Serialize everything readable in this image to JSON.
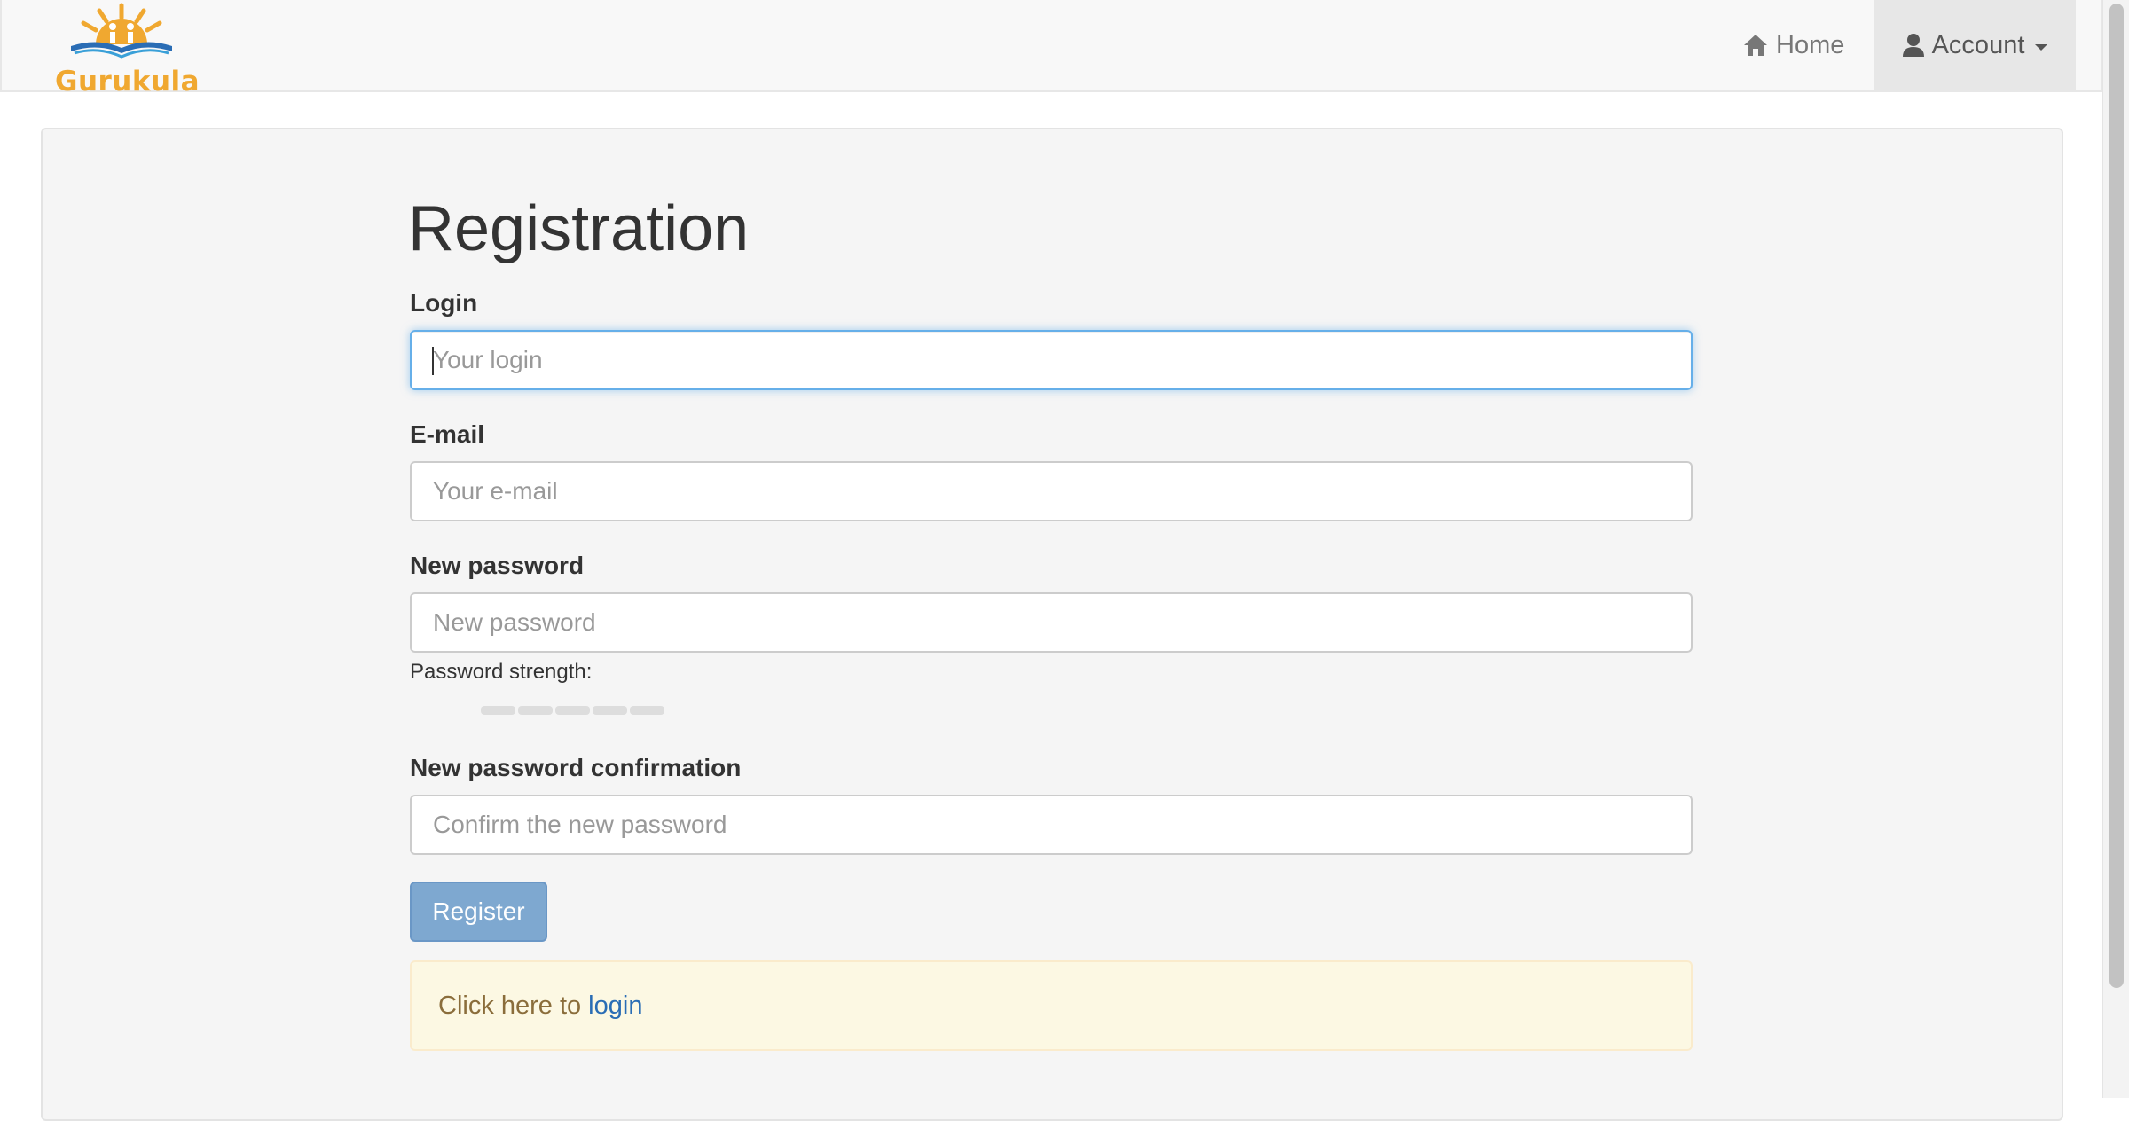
{
  "brand": {
    "name": "Gurukula",
    "logo_icon": "book-sun-logo-icon",
    "color": "#f0a830"
  },
  "nav": {
    "home_label": "Home",
    "home_icon": "home-icon",
    "account_label": "Account",
    "account_icon": "user-icon"
  },
  "form": {
    "title": "Registration",
    "login": {
      "label": "Login",
      "placeholder": "Your login",
      "value": ""
    },
    "email": {
      "label": "E-mail",
      "placeholder": "Your e-mail",
      "value": ""
    },
    "password": {
      "label": "New password",
      "placeholder": "New password",
      "value": ""
    },
    "password_strength_label": "Password strength:",
    "password_strength_segments": 5,
    "confirm": {
      "label": "New password confirmation",
      "placeholder": "Confirm the new password",
      "value": ""
    },
    "register_button": "Register"
  },
  "alert": {
    "text": "Click here to",
    "link": "login"
  },
  "colors": {
    "accent": "#66afe9",
    "button": "#7ea8d0",
    "alert_bg": "#fcf8e3",
    "link": "#2a6db5"
  }
}
